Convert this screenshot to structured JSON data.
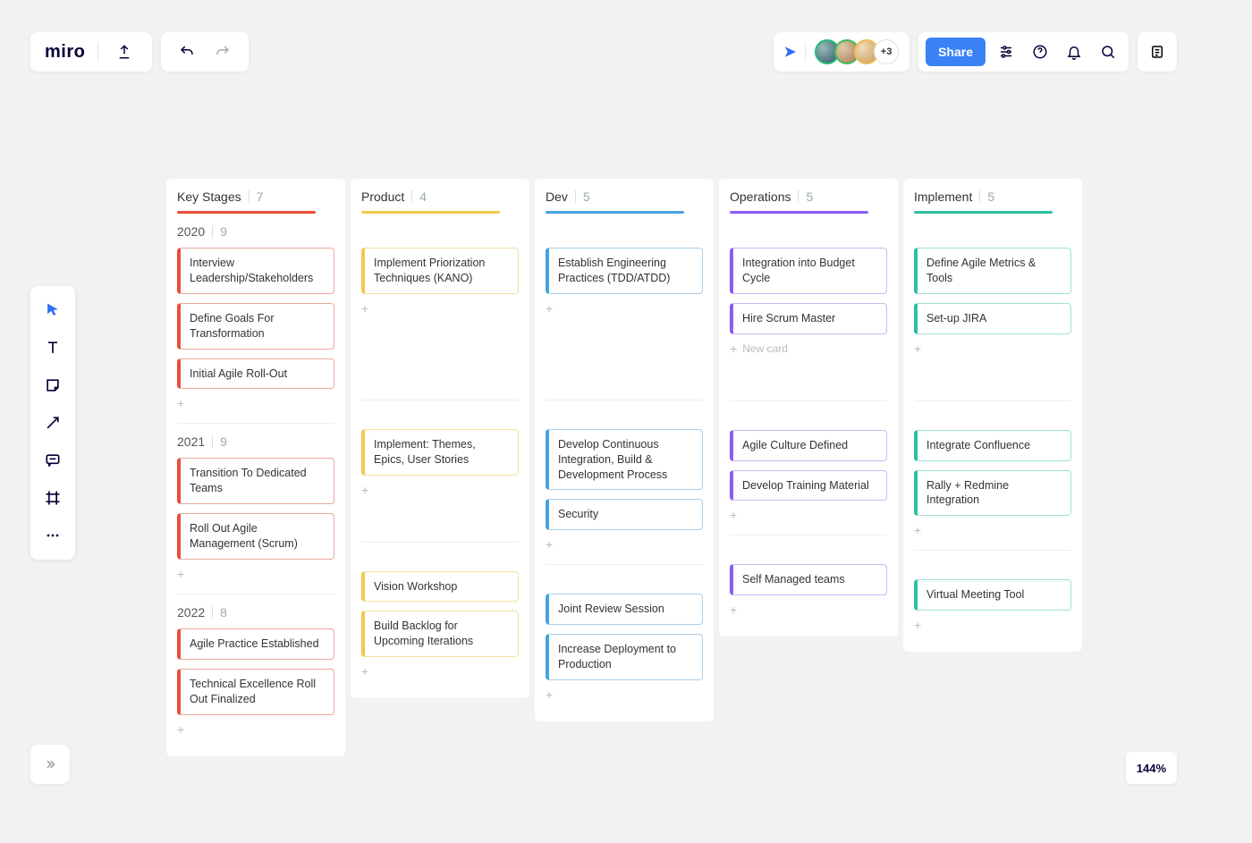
{
  "app": {
    "logo": "miro"
  },
  "collab": {
    "extra_count": "+3"
  },
  "share": {
    "label": "Share"
  },
  "zoom": {
    "level": "144%"
  },
  "ops_new_card": "New card",
  "columns": [
    {
      "title": "Key Stages",
      "count": "7",
      "color": "red"
    },
    {
      "title": "Product",
      "count": "4",
      "color": "yellow"
    },
    {
      "title": "Dev",
      "count": "5",
      "color": "blue"
    },
    {
      "title": "Operations",
      "count": "5",
      "color": "purple"
    },
    {
      "title": "Implement",
      "count": "5",
      "color": "teal"
    }
  ],
  "years": [
    {
      "label": "2020",
      "count": "9"
    },
    {
      "label": "2021",
      "count": "9"
    },
    {
      "label": "2022",
      "count": "8"
    }
  ],
  "cards": {
    "keystages_2020": [
      "Interview Leadership/Stakeholders",
      "Define Goals For Transformation",
      "Initial Agile Roll-Out"
    ],
    "keystages_2021": [
      "Transition To Dedicated Teams",
      "Roll Out Agile Management (Scrum)"
    ],
    "keystages_2022": [
      "Agile Practice Established",
      "Technical Excellence Roll Out Finalized"
    ],
    "product_2020": [
      "Implement Priorization Techniques (KANO)"
    ],
    "product_2021": [
      "Implement: Themes, Epics, User Stories"
    ],
    "product_2022": [
      "Vision Workshop",
      "Build Backlog for Upcoming Iterations"
    ],
    "dev_2020": [
      "Establish Engineering Practices (TDD/ATDD)"
    ],
    "dev_2021": [
      "Develop Continuous Integration, Build & Development Process",
      "Security"
    ],
    "dev_2022": [
      "Joint Review Session",
      "Increase Deployment to Production"
    ],
    "ops_2020": [
      "Integration into Budget Cycle",
      "Hire Scrum Master"
    ],
    "ops_2021": [
      "Agile Culture Defined",
      "Develop Training Material"
    ],
    "ops_2022": [
      "Self Managed teams"
    ],
    "impl_2020": [
      "Define Agile Metrics & Tools",
      "Set-up JIRA"
    ],
    "impl_2021": [
      "Integrate Confluence",
      "Rally + Redmine Integration"
    ],
    "impl_2022": [
      "Virtual Meeting Tool"
    ]
  }
}
